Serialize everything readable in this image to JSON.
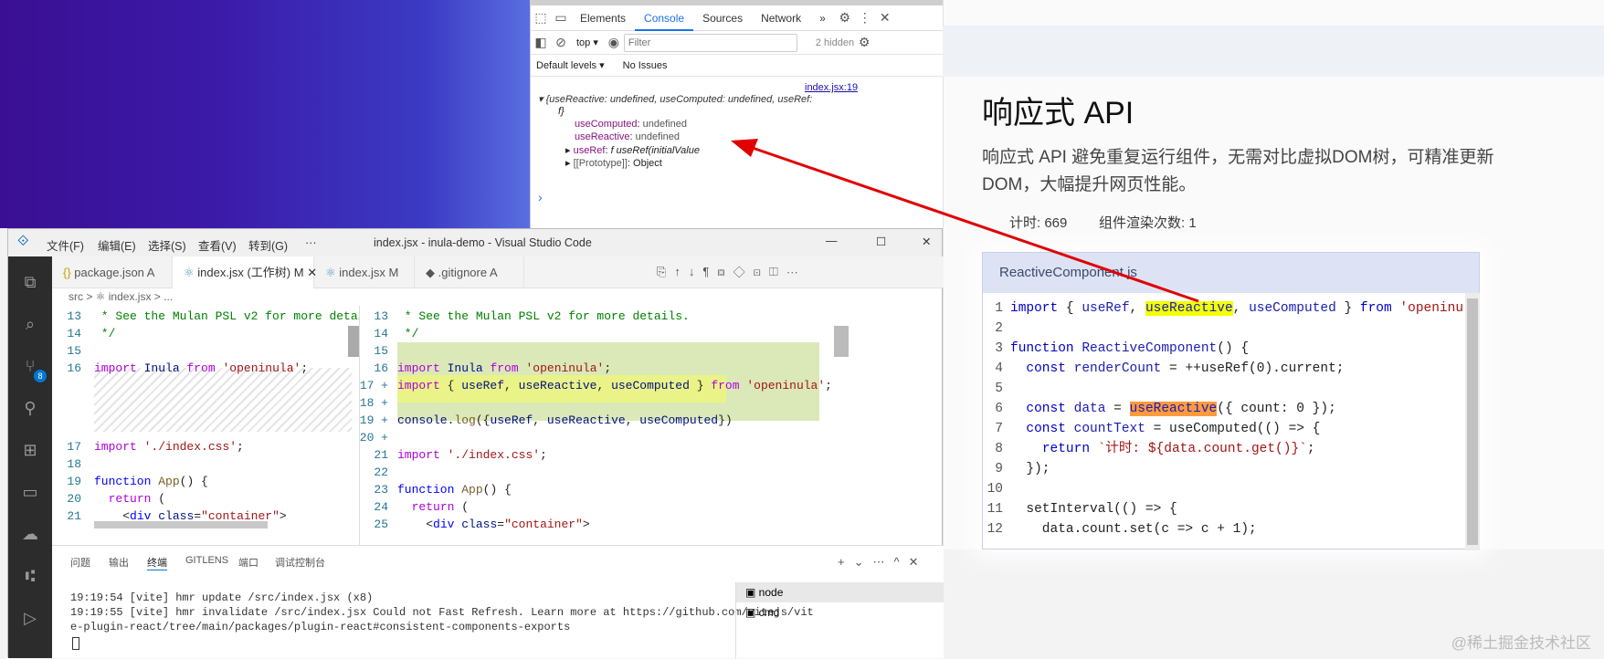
{
  "devtools": {
    "tabs": [
      "Elements",
      "Console",
      "Sources",
      "Network"
    ],
    "more": "»",
    "context": "top",
    "filter_placeholder": "Filter",
    "hidden": "2 hidden",
    "levels": "Default levels",
    "issues": "No Issues",
    "source_link": "index.jsx:19",
    "log_summary": "{useReactive: undefined, useComputed: undefined, useRef:",
    "log_summary2": "f}",
    "entries": [
      {
        "key": "useComputed",
        "value": "undefined"
      },
      {
        "key": "useReactive",
        "value": "undefined"
      },
      {
        "key": "useRef",
        "value": "f useRef(initialValue"
      },
      {
        "key": "[[Prototype]]",
        "value": "Object"
      }
    ],
    "prompt": "›"
  },
  "page": {
    "title": "响应式 API",
    "desc": "响应式 API 避免重复运行组件，无需对比虚拟DOM树，可精准更新DOM，大幅提升网页性能。",
    "timer": "计时: 669",
    "renders": "组件渲染次数: 1",
    "card_title": "ReactiveComponent.js",
    "card_lines": [
      "1",
      "2",
      "3",
      "4",
      "5",
      "6",
      "7",
      "8",
      "9",
      "10",
      "11",
      "12"
    ]
  },
  "vscode": {
    "menus": [
      "文件(F)",
      "编辑(E)",
      "选择(S)",
      "查看(V)",
      "转到(G)",
      "···"
    ],
    "title": "index.jsx - inula-demo - Visual Studio Code",
    "tabs": [
      "package.json A",
      "index.jsx (工作树) M",
      "index.jsx M",
      ".gitignore A"
    ],
    "crumb": "src  >  ⚛ index.jsx  >  ...",
    "panel_tabs": [
      "问题",
      "输出",
      "终端",
      "GITLENS",
      "端口",
      "调试控制台"
    ],
    "terminals": [
      "node",
      "cmd"
    ],
    "term_lines": [
      "19:19:54 [vite] hmr update /src/index.jsx (x8)",
      "19:19:55 [vite] hmr invalidate /src/index.jsx Could not Fast Refresh. Learn more at https://github.com/vitejs/vit",
      "e-plugin-react/tree/main/packages/plugin-react#consistent-components-exports"
    ],
    "badge": "8"
  },
  "watermark": "@稀土掘金技术社区",
  "colors": {
    "accent": "#1a73e8",
    "highlight_yellow": "#f4ff00",
    "highlight_orange": "#ff9a3d",
    "arrow": "#e00000"
  }
}
